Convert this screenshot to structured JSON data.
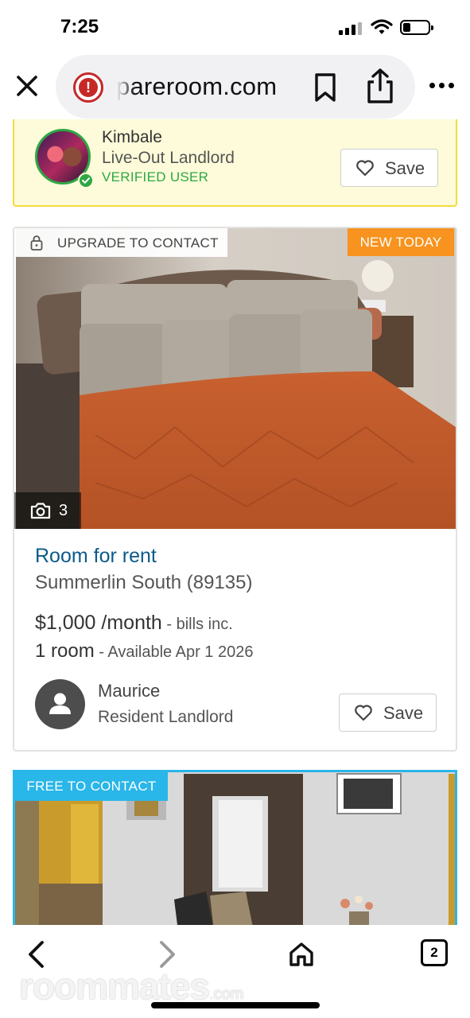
{
  "status_bar": {
    "time": "7:25",
    "battery_icon": "battery-low-icon",
    "signal_icon": "cellular-signal-icon",
    "wifi_icon": "wifi-icon"
  },
  "browser": {
    "url": "pareroom.com",
    "security_icon": "not-secure-warning-icon",
    "icons": [
      "close-icon",
      "bookmark-icon",
      "share-icon",
      "more-icon"
    ]
  },
  "featured_card": {
    "name": "Kimbale",
    "type": "Live-Out Landlord",
    "verified": "VERIFIED USER",
    "save_label": "Save",
    "accent_color": "#2ea745",
    "background_color": "#fdfbd9"
  },
  "listing": {
    "upgrade_badge": "UPGRADE TO CONTACT",
    "new_badge": "NEW TODAY",
    "photo_count": "3",
    "title": "Room for rent",
    "area": "Summerlin South (89135)",
    "price": "$1,000 /month",
    "price_note": " - bills inc.",
    "rooms": "1 room",
    "availability": " - Available Apr 1 2026",
    "host_name": "Maurice",
    "host_type": "Resident Landlord",
    "save_label": "Save",
    "title_color": "#0d5a8a",
    "new_badge_color": "#f7931e"
  },
  "second_listing": {
    "badge": "FREE TO CONTACT",
    "badge_color": "#29b6e8"
  },
  "bottom_nav": {
    "tab_count": "2",
    "icons": [
      "back-icon",
      "forward-icon",
      "home-icon",
      "tabs-icon"
    ]
  },
  "watermark": {
    "name": "roommates",
    "domain": ".com"
  }
}
